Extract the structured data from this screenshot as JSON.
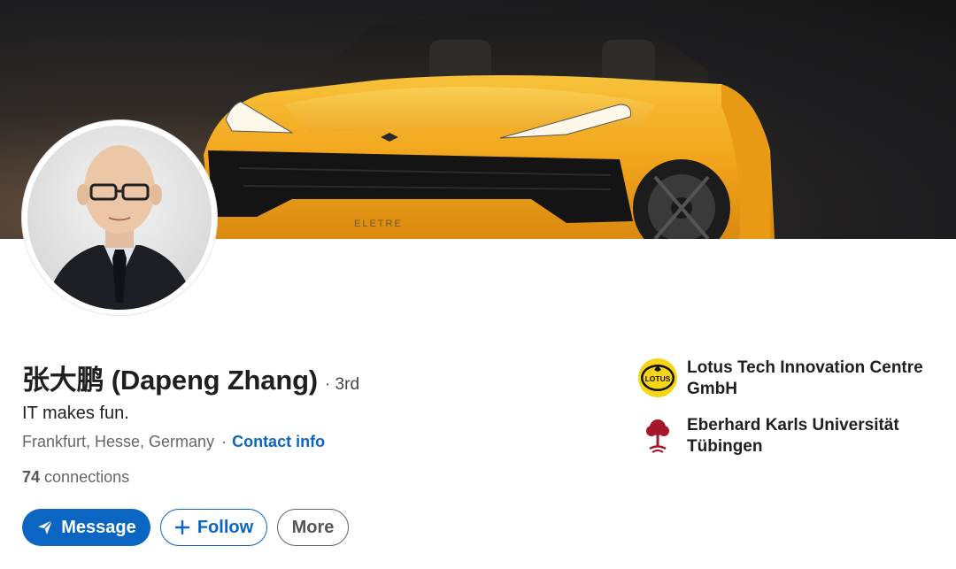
{
  "profile": {
    "name": "张大鹏 (Dapeng Zhang)",
    "degree": "· 3rd",
    "headline": "IT makes fun.",
    "location": "Frankfurt, Hesse, Germany",
    "contact_label": "Contact info",
    "connections_count": "74",
    "connections_label": "connections"
  },
  "banner": {
    "car_badge_text": "ELETRE"
  },
  "actions": {
    "message_label": "Message",
    "follow_label": "Follow",
    "more_label": "More"
  },
  "orgs": [
    {
      "name_line1": "Lotus Tech Innovation Centre",
      "name_line2": "GmbH",
      "logo_text": "LOTUS",
      "logo_icon": "lotus-logo"
    },
    {
      "name_line1": "Eberhard Karls Universität",
      "name_line2": "Tübingen",
      "logo_icon": "university-tree-logo"
    }
  ],
  "colors": {
    "accent": "#0a66c2",
    "lotus_yellow": "#f5d514",
    "university_red": "#a5162b",
    "car_orange": "#f2a51c"
  }
}
